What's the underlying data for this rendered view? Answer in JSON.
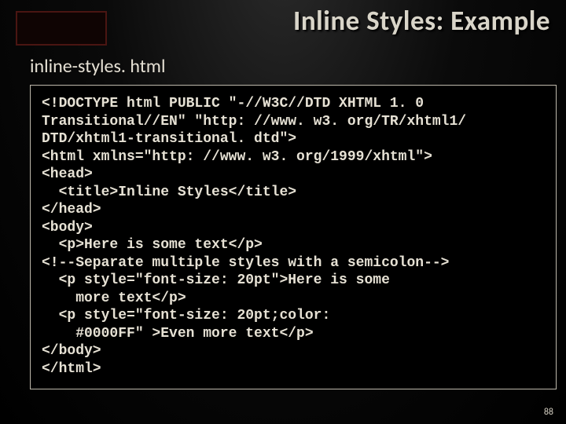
{
  "title": "Inline Styles: Example",
  "subtitle": "inline-styles. html",
  "code": "<!DOCTYPE html PUBLIC \"-//W3C//DTD XHTML 1. 0\nTransitional//EN\" \"http: //www. w3. org/TR/xhtml1/\nDTD/xhtml1-transitional. dtd\">\n<html xmlns=\"http: //www. w3. org/1999/xhtml\">\n<head>\n  <title>Inline Styles</title>\n</head>\n<body>\n  <p>Here is some text</p>\n<!--Separate multiple styles with a semicolon-->\n  <p style=\"font-size: 20pt\">Here is some\n    more text</p>\n  <p style=\"font-size: 20pt;color:\n    #0000FF\" >Even more text</p>\n</body>\n</html>",
  "slide_number": "88"
}
